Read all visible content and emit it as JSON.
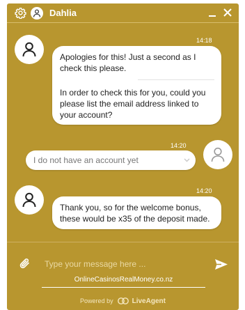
{
  "colors": {
    "accent": "#b8962f",
    "bubble": "#ffffff",
    "text": "#222222"
  },
  "header": {
    "agent_name": "Dahlia",
    "icons": [
      "gear-icon",
      "user-avatar-icon",
      "minimize-icon",
      "close-icon"
    ]
  },
  "messages": [
    {
      "sender": "agent",
      "time": "14:18",
      "paragraphs": [
        "Apologies for this! Just a second as I check this please.",
        "In order to check this for you, could you please list the email address linked to your account?"
      ]
    },
    {
      "sender": "visitor",
      "time": "14:20",
      "text": "I do not have an account yet"
    },
    {
      "sender": "agent",
      "time": "14:20",
      "paragraphs": [
        "Thank you, so for the welcome bonus, these would be x35 of the deposit made."
      ]
    }
  ],
  "composer": {
    "placeholder": "Type your message here ...",
    "value": ""
  },
  "watermark": "OnlineCasinosRealMoney.co.nz",
  "footer": {
    "powered_by": "Powered by",
    "brand": "LiveAgent"
  }
}
